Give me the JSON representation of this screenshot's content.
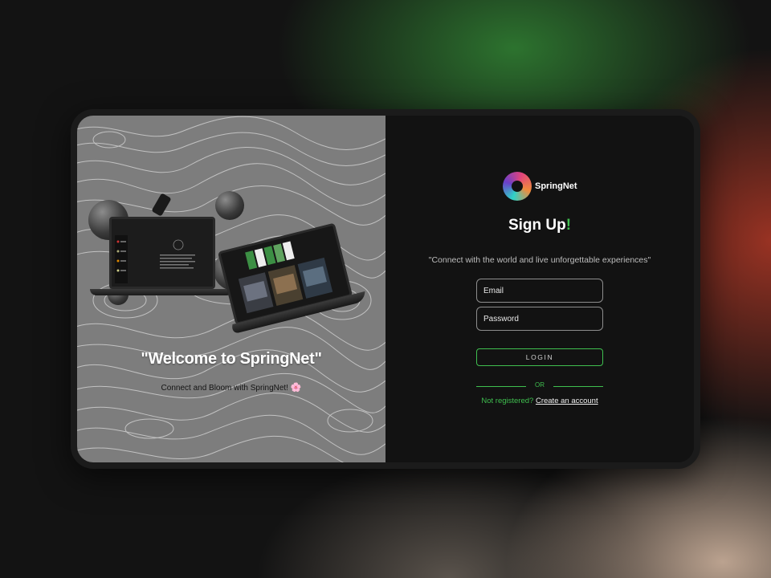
{
  "left_panel": {
    "welcome_title": "\"Welcome to SpringNet\"",
    "welcome_subtitle": "Connect and Bloom with SpringNet!",
    "flower_icon": "🌸"
  },
  "right_panel": {
    "logo_text": "SpringNet",
    "heading": "Sign Up",
    "heading_accent": "!",
    "tagline": "\"Connect with the world and live unforgettable experiences\"",
    "email_placeholder": "Email",
    "password_placeholder": "Password",
    "login_label": "LOGIN",
    "or_label": "OR",
    "not_registered": "Not registered?",
    "create_account": "Create an account"
  },
  "colors": {
    "accent_green": "#3fbf4f",
    "card_dark": "#121212"
  }
}
